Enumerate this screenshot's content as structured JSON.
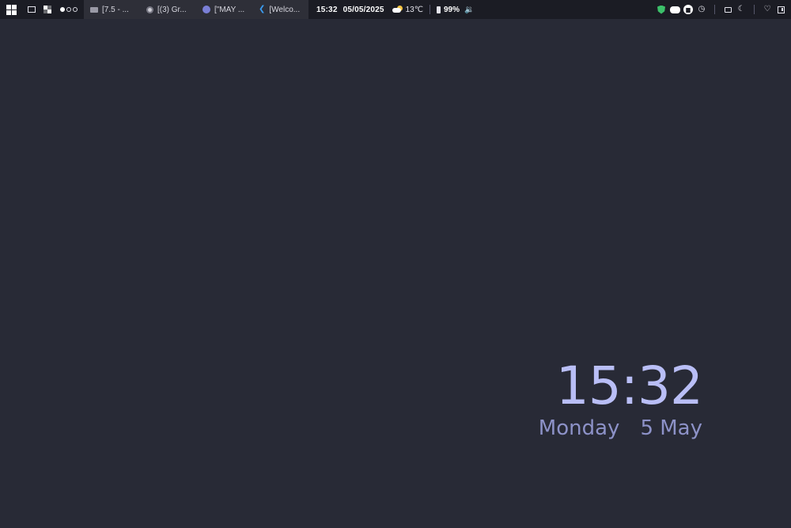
{
  "taskbar": {
    "workspaces": [
      {
        "active": true
      },
      {
        "active": false
      },
      {
        "active": false
      }
    ],
    "tasks": [
      {
        "label": "[7.5 - ...",
        "icon": "folder-icon"
      },
      {
        "label": "[(3) Gr...",
        "icon": "chrome-icon"
      },
      {
        "label": "[\"MAY ...",
        "icon": "discord-icon"
      },
      {
        "label": "[Welco...",
        "icon": "vscode-icon"
      }
    ],
    "time": "15:32",
    "date": "05/05/2025",
    "weather": {
      "temp": "13℃",
      "icon": "partly-cloudy-icon"
    },
    "battery": "99%",
    "tray_icons": [
      "shield-icon",
      "discord-icon",
      "spotify-icon",
      "wifi-icon",
      "printer-icon",
      "moon-icon",
      "bell-icon",
      "panel-icon"
    ]
  },
  "desktop_clock": {
    "time": "15:32",
    "weekday": "Monday",
    "date": "5 May"
  },
  "colors": {
    "desktop_bg": "#282a36",
    "bar_bg": "#1b1c24",
    "clock_time": "#b9bef6",
    "clock_date": "#8d92c8",
    "shield": "#3cc06a"
  }
}
